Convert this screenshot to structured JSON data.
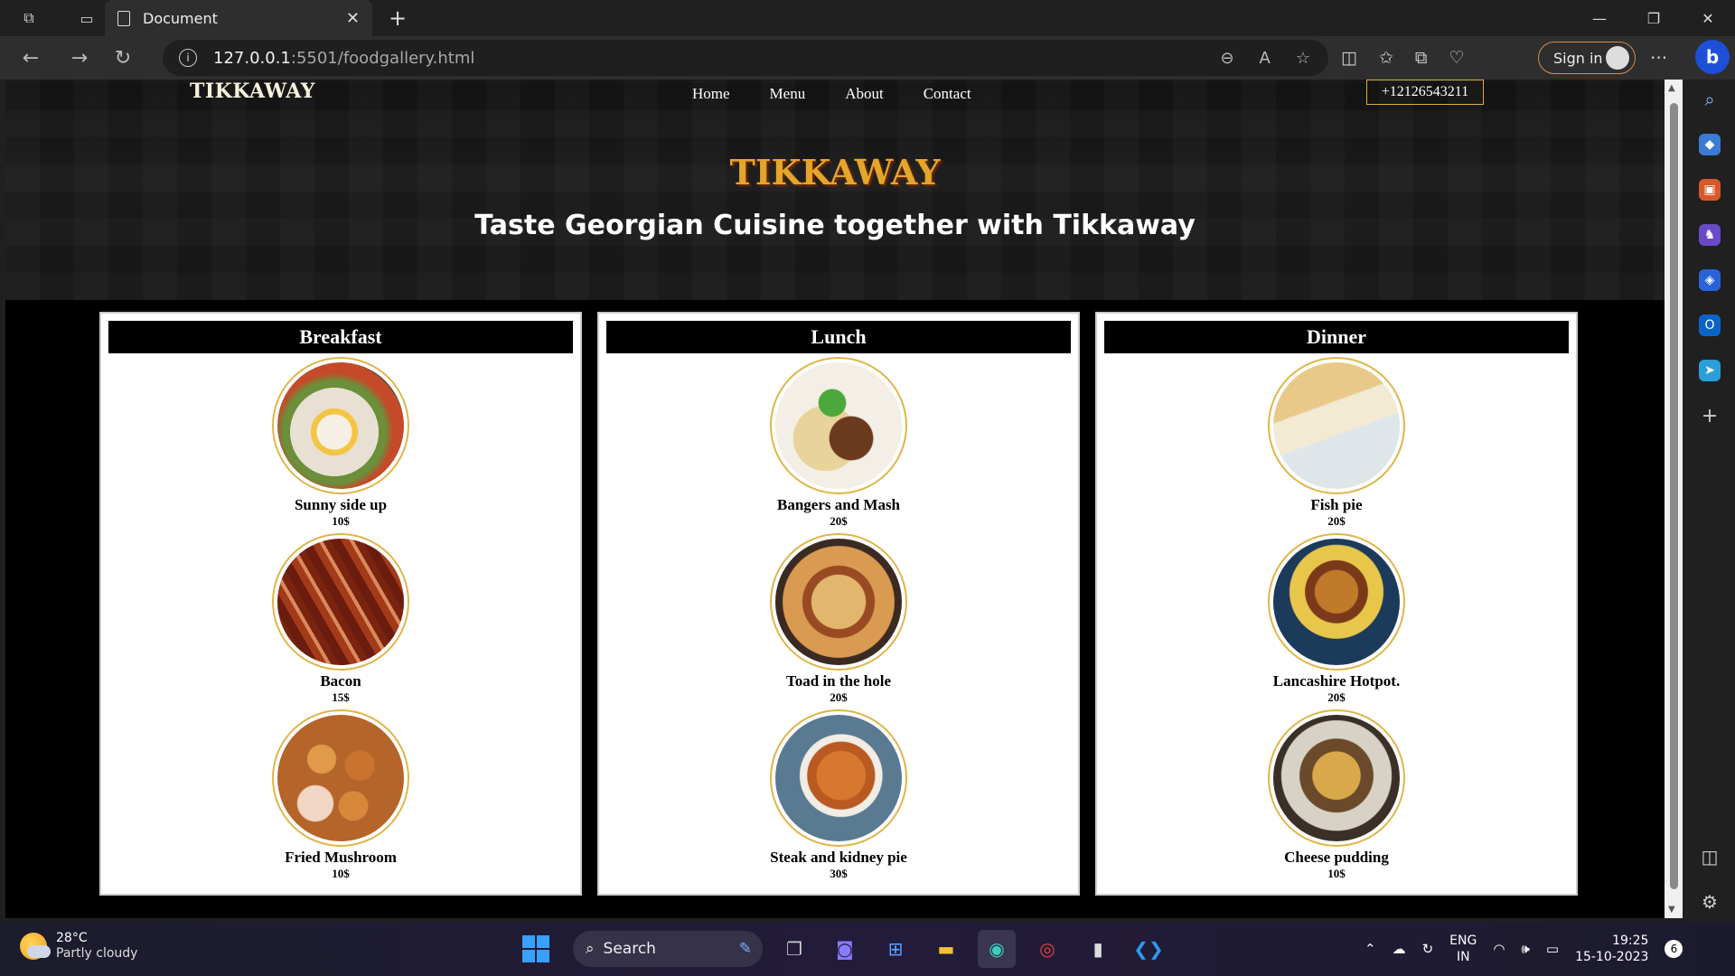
{
  "browser": {
    "tab_title": "Document",
    "url_host": "127.0.0.1",
    "url_path": ":5501/foodgallery.html",
    "sign_in_label": "Sign in"
  },
  "site": {
    "logo": "TIKKAWAY",
    "nav": [
      "Home",
      "Menu",
      "About",
      "Contact"
    ],
    "phone": "+12126543211",
    "hero_title": "TIKKAWAY",
    "hero_subtitle": "Taste Georgian Cuisine together with Tikkaway",
    "accent_color": "#e3a62a"
  },
  "menus": [
    {
      "title": "Breakfast",
      "items": [
        {
          "name": "Sunny side up",
          "price": "10$"
        },
        {
          "name": "Bacon",
          "price": "15$"
        },
        {
          "name": "Fried Mushroom",
          "price": "10$"
        }
      ]
    },
    {
      "title": "Lunch",
      "items": [
        {
          "name": "Bangers and Mash",
          "price": "20$"
        },
        {
          "name": "Toad in the hole",
          "price": "20$"
        },
        {
          "name": "Steak and kidney pie",
          "price": "30$"
        }
      ]
    },
    {
      "title": "Dinner",
      "items": [
        {
          "name": "Fish pie",
          "price": "20$"
        },
        {
          "name": "Lancashire Hotpot.",
          "price": "20$"
        },
        {
          "name": "Cheese pudding",
          "price": "10$"
        }
      ]
    }
  ],
  "taskbar": {
    "temperature": "28°C",
    "weather": "Partly cloudy",
    "search_label": "Search",
    "lang_1": "ENG",
    "lang_2": "IN",
    "time": "19:25",
    "date": "15-10-2023",
    "notifications": "6"
  }
}
